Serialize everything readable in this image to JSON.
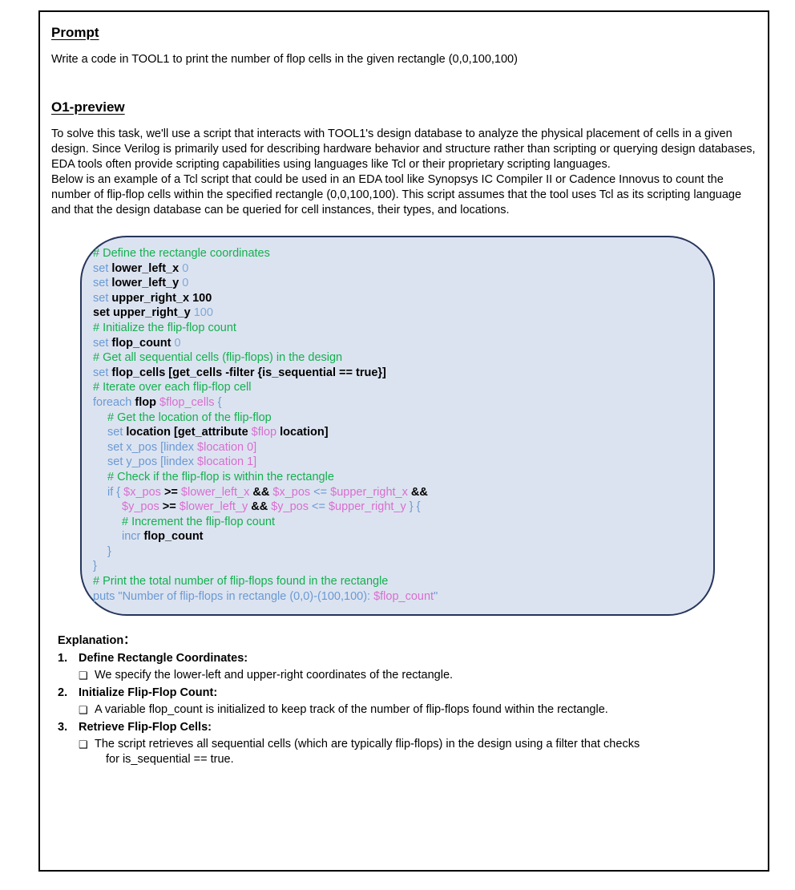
{
  "page": {
    "prompt_heading": "Prompt",
    "prompt_text": "Write a code in TOOL1 to print the number of flop cells in the given rectangle (0,0,100,100)",
    "model_heading": "O1-preview",
    "intro_paragraph_1": "To solve this task, we'll use a script that interacts with TOOL1's design database to analyze the physical placement of cells in a given design. Since Verilog is primarily used for describing hardware behavior and structure rather than scripting or querying design databases, EDA tools often provide scripting capabilities using languages like Tcl or their proprietary scripting languages.",
    "intro_paragraph_2": "Below is an example of a Tcl script that could be used in an EDA tool like Synopsys IC Compiler II or Cadence Innovus to count the number of flip-flop cells within the specified rectangle (0,0,100,100). This script assumes that the tool uses Tcl as its scripting language and that the design database can be queried for cell instances, their types, and locations."
  },
  "code_block": {
    "language": "tcl",
    "background_color": "#dce3f0",
    "border_color": "#26355c",
    "colors": {
      "comment": "#13b04f",
      "keyword": "#6a9ad4",
      "variable": "#d86fd0",
      "number": "#7fa9d8",
      "plain": "#000000"
    },
    "lines": [
      "# Define the rectangle coordinates",
      "set lower_left_x 0",
      "set lower_left_y 0",
      "set upper_right_x 100",
      "set upper_right_y 100",
      "# Initialize the flip-flop count",
      "set flop_count 0",
      "# Get all sequential cells (flip-flops) in the design",
      "set flop_cells [get_cells -filter {is_sequential == true}]",
      "# Iterate over each flip-flop cell",
      "foreach flop $flop_cells {",
      "   # Get the location of the flip-flop",
      "   set location [get_attribute $flop location]",
      "   set x_pos [lindex $location 0]",
      "   set y_pos [lindex $location 1]",
      "   # Check if the flip-flop is within the rectangle",
      "   if { $x_pos >= $lower_left_x && $x_pos <= $upper_right_x &&",
      "      $y_pos >= $lower_left_y && $y_pos <= $upper_right_y } {",
      "      # Increment the flip-flop count",
      "      incr flop_count",
      "   }",
      "}",
      "# Print the total number of flip-flops found in the rectangle",
      "puts \"Number of flip-flops in rectangle (0,0)-(100,100): $flop_count\""
    ]
  },
  "explanation": {
    "title": "Explanation：",
    "items": [
      {
        "number": "1.",
        "heading": "Define Rectangle Coordinates:",
        "bullet_glyph": "❑",
        "detail": "We specify the lower-left and upper-right coordinates of the rectangle.",
        "detail_continuation": ""
      },
      {
        "number": "2.",
        "heading": "Initialize Flip-Flop Count:",
        "bullet_glyph": "❑",
        "detail": "A variable flop_count is initialized to keep track of the number of flip-flops found within the rectangle.",
        "detail_continuation": ""
      },
      {
        "number": "3.",
        "heading": "Retrieve Flip-Flop Cells:",
        "bullet_glyph": "❑",
        "detail": "The script retrieves all sequential cells (which are typically flip-flops) in the design using a filter that checks",
        "detail_continuation": "for is_sequential == true."
      }
    ]
  }
}
